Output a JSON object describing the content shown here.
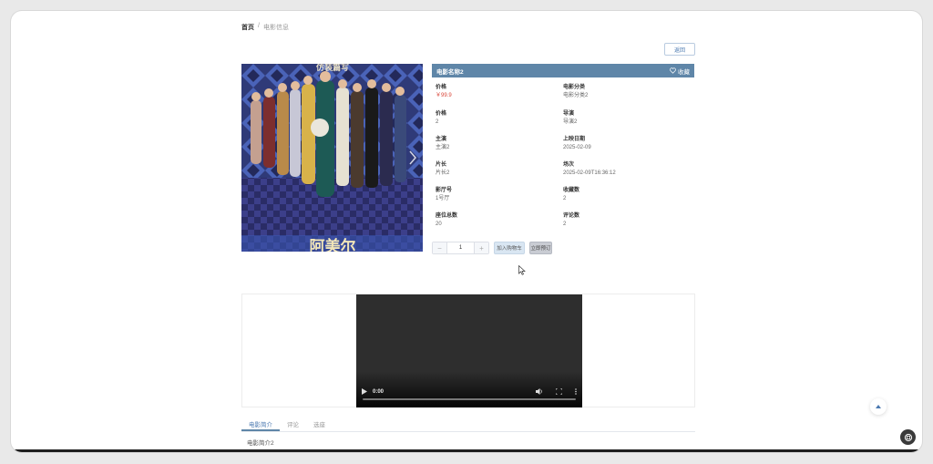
{
  "breadcrumb": {
    "home": "首页",
    "separator": "/",
    "current": "电影信息"
  },
  "back_label": "返回",
  "poster": {
    "overlay_top": "仿装篇写",
    "overlay_bottom": "阿美尔"
  },
  "movie": {
    "name": "电影名称2",
    "favorite_label": "收藏",
    "fields": [
      {
        "label": "价格",
        "value": "￥99.9",
        "price": true
      },
      {
        "label": "电影分类",
        "value": "电影分类2"
      },
      {
        "label": "价格",
        "value": "2"
      },
      {
        "label": "导演",
        "value": "导演2"
      },
      {
        "label": "主演",
        "value": "主演2"
      },
      {
        "label": "上映日期",
        "value": "2025-02-09"
      },
      {
        "label": "片长",
        "value": "片长2"
      },
      {
        "label": "场次",
        "value": "2025-02-09T16:36:12"
      },
      {
        "label": "影厅号",
        "value": "1号厅"
      },
      {
        "label": "收藏数",
        "value": "2"
      },
      {
        "label": "座位总数",
        "value": "20"
      },
      {
        "label": "评论数",
        "value": "2"
      }
    ]
  },
  "purchase": {
    "quantity": "1",
    "minus": "−",
    "plus": "+",
    "cart_label": "加入购物车",
    "order_label": "立即预订"
  },
  "video": {
    "time": "0:00"
  },
  "tabs": [
    {
      "label": "电影简介",
      "active": true
    },
    {
      "label": "评论",
      "active": false
    },
    {
      "label": "选座",
      "active": false
    }
  ],
  "tab_content": "电影简介2",
  "colors": {
    "header": "#5f86a8",
    "price": "#d9473a",
    "accent": "#4a78b0"
  }
}
